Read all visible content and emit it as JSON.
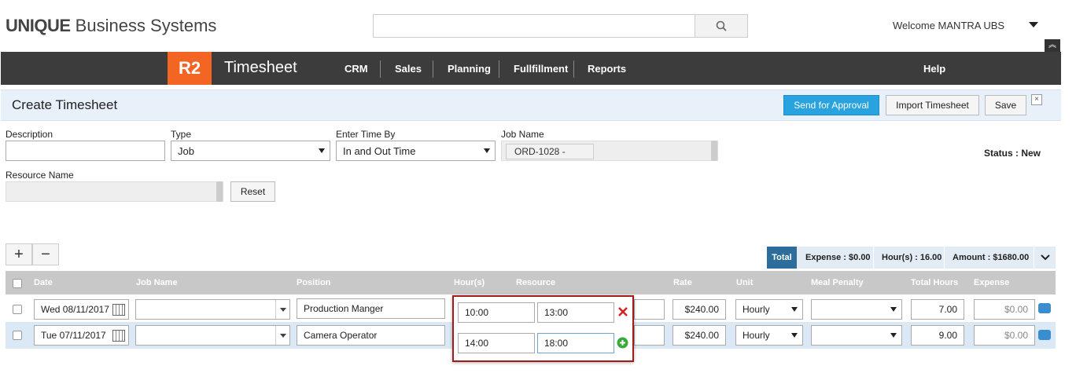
{
  "header": {
    "brand_bold": "UNIQUE",
    "brand_rest": " Business Systems",
    "search_placeholder": "",
    "welcome": "Welcome MANTRA UBS"
  },
  "nav": {
    "logo": "R2",
    "app_title": "Timesheet",
    "items": [
      "CRM",
      "Sales",
      "Planning",
      "Fullfillment",
      "Reports"
    ],
    "help": "Help"
  },
  "page": {
    "title": "Create Timesheet",
    "send_approval": "Send for Approval",
    "import": "Import Timesheet",
    "save": "Save",
    "close": "×"
  },
  "form": {
    "description_label": "Description",
    "description_value": "",
    "type_label": "Type",
    "type_value": "Job",
    "enter_time_label": "Enter Time By",
    "enter_time_value": "In and Out Time",
    "job_name_label": "Job Name",
    "job_name_chip": "ORD-1028 -",
    "resource_label": "Resource Name",
    "reset": "Reset",
    "status": "Status : New"
  },
  "totals": {
    "tab": "Total",
    "expense": "Expense : $0.00",
    "hours": "Hour(s) : 16.00",
    "amount": "Amount : $1680.00"
  },
  "grid": {
    "headers": [
      "Date",
      "Job Name",
      "Position",
      "Hour(s)",
      "Resource",
      "Rate",
      "Unit",
      "Meal Penalty",
      "Total Hours",
      "Expense"
    ],
    "rows": [
      {
        "date": "Wed 08/11/2017",
        "job": "",
        "position": "Production Manger",
        "rate": "$240.00",
        "unit": "Hourly",
        "meal": "",
        "total": "7.00",
        "expense": "$0.00"
      },
      {
        "date": "Tue 07/11/2017",
        "job": "",
        "position": "Camera Operator",
        "rate": "$240.00",
        "unit": "Hourly",
        "meal": "",
        "total": "9.00",
        "expense": "$0.00"
      }
    ]
  },
  "hours_popup": {
    "entries": [
      {
        "in": "10:00",
        "out": "13:00"
      },
      {
        "in": "14:00",
        "out": "18:00"
      }
    ]
  },
  "colors": {
    "accent": "#f26522",
    "nav_bg": "#3c3c3c",
    "primary": "#29a3e0",
    "popup_border": "#a21b1b"
  }
}
